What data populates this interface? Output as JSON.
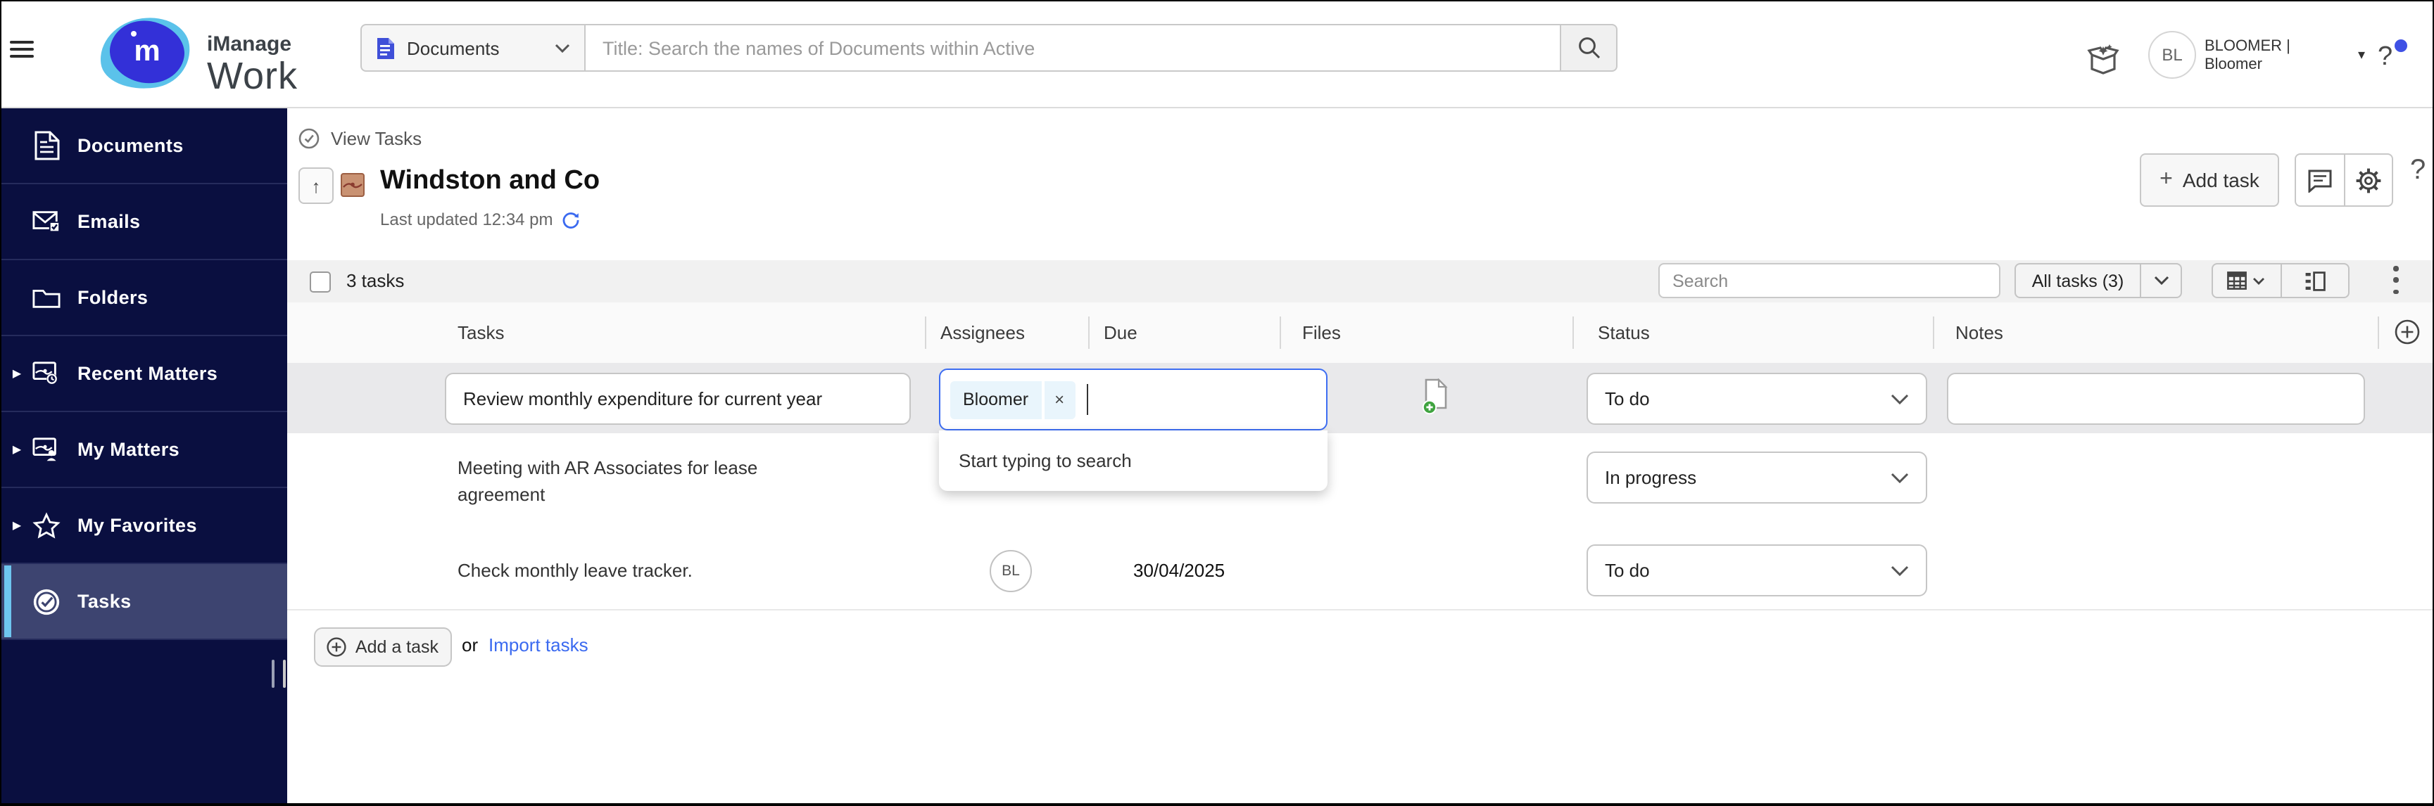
{
  "topbar": {
    "logo_line1": "iManage",
    "logo_line2": "Work",
    "logo_letter": "m",
    "search_scope": "Documents",
    "search_placeholder": "Title: Search the names of Documents within Active",
    "user_initials": "BL",
    "user_name_line1": "BLOOMER |",
    "user_name_line2": "Bloomer"
  },
  "sidebar": {
    "items": [
      {
        "label": "Documents"
      },
      {
        "label": "Emails"
      },
      {
        "label": "Folders"
      },
      {
        "label": "Recent Matters"
      },
      {
        "label": "My Matters"
      },
      {
        "label": "My Favorites"
      },
      {
        "label": "Tasks"
      }
    ]
  },
  "page": {
    "breadcrumb": "View Tasks",
    "title": "Windston and Co",
    "last_updated": "Last updated 12:34 pm",
    "add_task_plus": "+",
    "add_task_label": "Add task",
    "help_label": "?"
  },
  "toolbar": {
    "selection_count": "3 tasks",
    "search_placeholder": "Search",
    "filter_label": "All tasks (3)"
  },
  "table": {
    "columns": [
      "Tasks",
      "Assignees",
      "Due",
      "Files",
      "Status",
      "Notes"
    ],
    "assignee_dropdown_hint": "Start typing to search",
    "rows": [
      {
        "task": "Review monthly expenditure for current year",
        "assignee_chip": "Bloomer",
        "chip_remove": "×",
        "status": "To do",
        "notes": ""
      },
      {
        "task": "Meeting with AR Associates for lease agreement",
        "status": "In progress"
      },
      {
        "task": "Check monthly leave tracker.",
        "assignee_initials": "BL",
        "due": "30/04/2025",
        "status": "To do"
      }
    ]
  },
  "footer": {
    "add_a_task": "Add a task",
    "or": "or",
    "import_tasks": "Import tasks"
  },
  "colors": {
    "sidebar_bg": "#0a0f40",
    "sidebar_selected_bg": "#3d4470",
    "sidebar_accent": "#6ec6ef",
    "focus_blue": "#3d6df2",
    "link_blue": "#3b6af0",
    "chip_bg": "#e9f5fc",
    "editing_row_bg": "#e9e9eb",
    "file_add_green": "#3fa33f",
    "logo_indigo": "#3330d8",
    "logo_lightblue": "#5bc2ea",
    "notification_dot": "#3f51e5",
    "matter_icon_tan": "#c99273"
  }
}
